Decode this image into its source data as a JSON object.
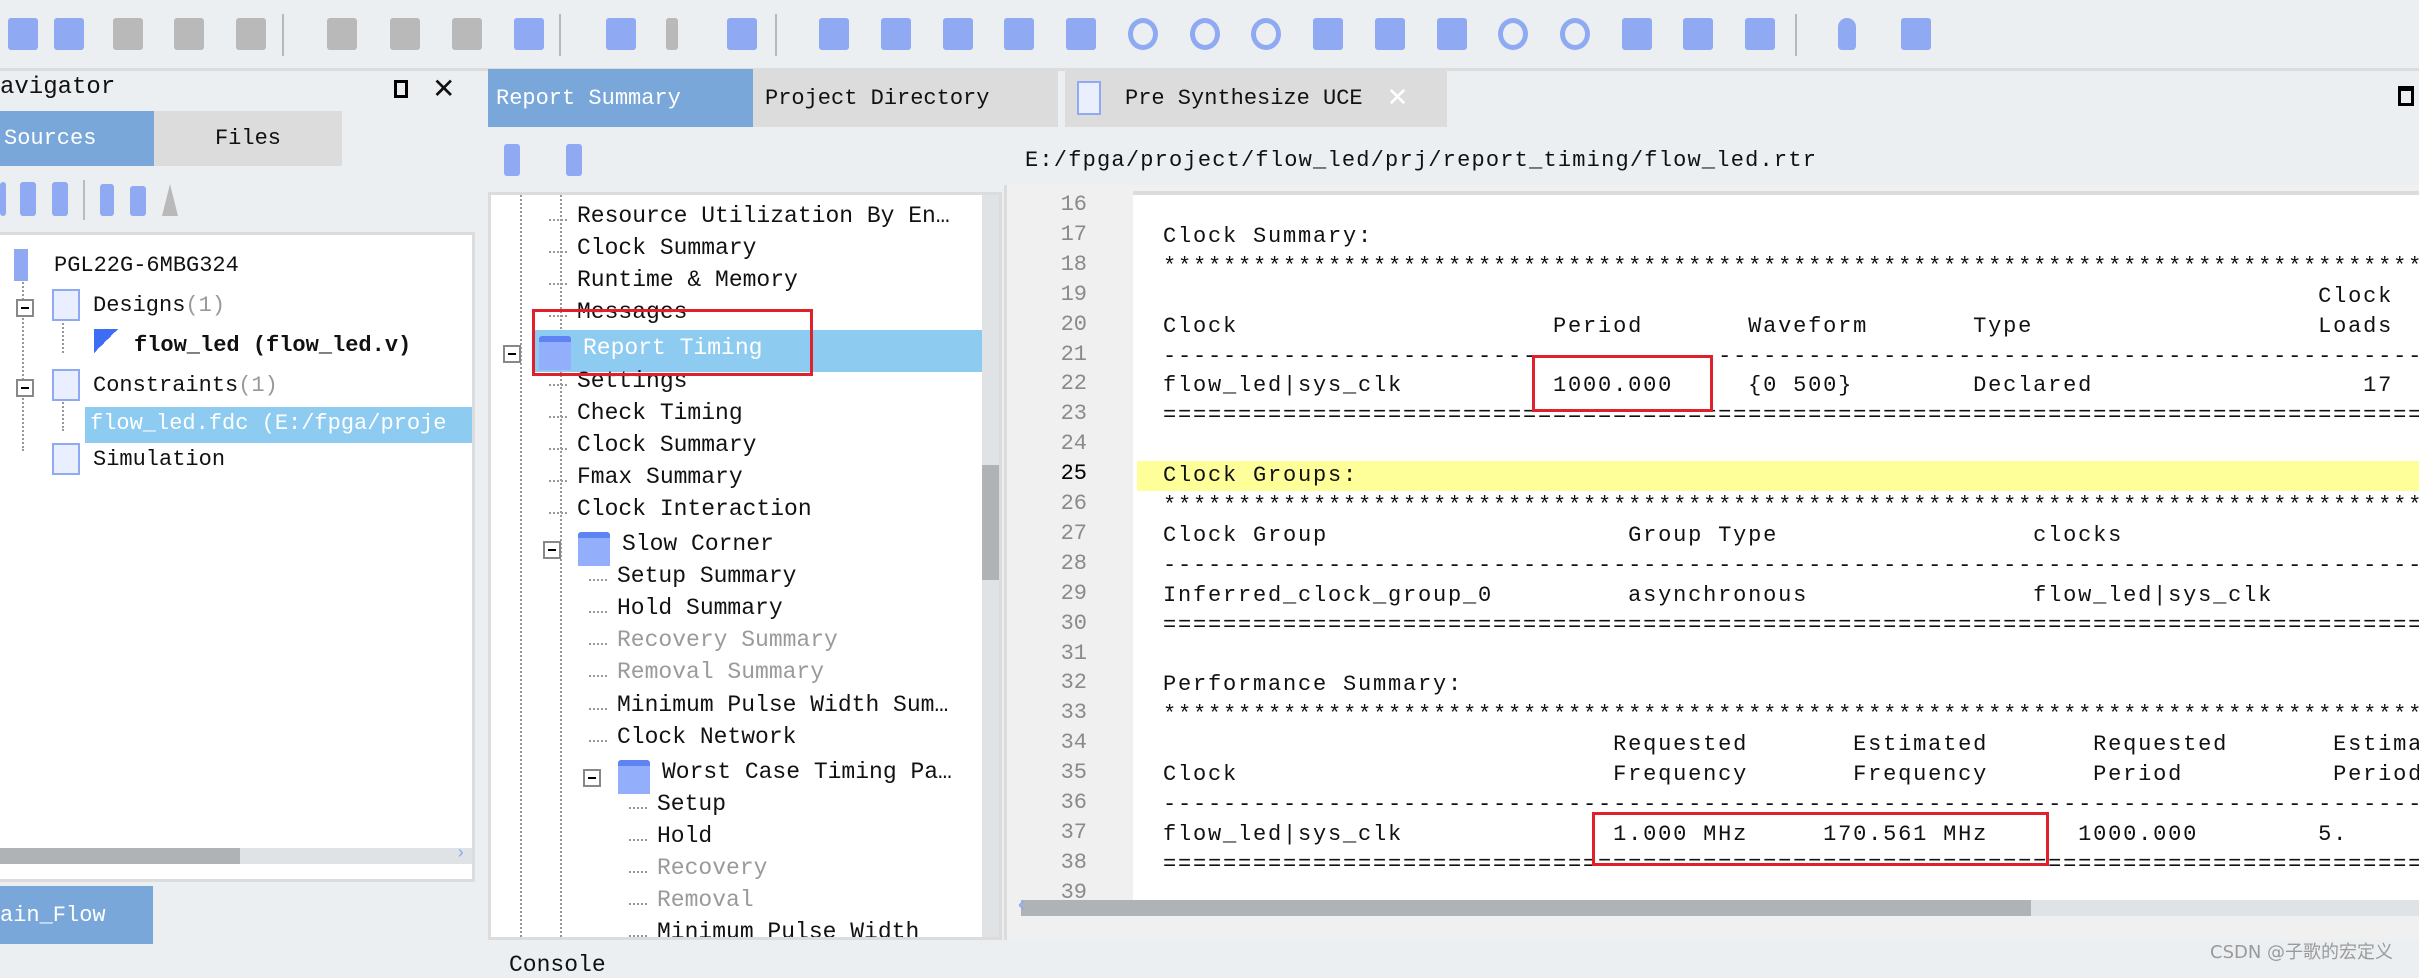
{
  "toolbar": {
    "icons": [
      "new-file-icon",
      "open-folder-icon",
      "save-icon",
      "save-as-icon",
      "save-all-icon",
      "cut-icon",
      "copy-icon",
      "paste-icon",
      "find-icon",
      "run-icon",
      "pause-icon",
      "settings-gear-icon",
      "edit-constraints-icon",
      "report-icon",
      "schematic-icon",
      "hierarchy-icon",
      "device-map-icon",
      "flash-refresh-icon",
      "timing-refresh-icon",
      "waveform-icon",
      "timing-analyzer-icon",
      "io-icon",
      "debug-bug-icon",
      "download-icon",
      "ip-icon",
      "chart-icon",
      "net-tree-icon",
      "org-tree-icon",
      "tip-bulb-icon",
      "exit-icon"
    ]
  },
  "navigator": {
    "title": "avigator",
    "tabs": [
      {
        "label": "Sources"
      },
      {
        "label": "Files"
      }
    ],
    "tree": [
      {
        "label": "PGL22G-6MBG324",
        "icon": "chip-icon"
      },
      {
        "label": "Designs",
        "count": "(1)",
        "icon": "document-icon"
      },
      {
        "label": "flow_led (flow_led.v)",
        "icon": "verilog-module-icon",
        "bold": true
      },
      {
        "label": "Constraints",
        "count": "(1)",
        "icon": "constraints-icon"
      },
      {
        "label": "flow_led.fdc (E:/fpga/proje",
        "selected": true
      },
      {
        "label": "Simulation",
        "icon": "document-icon"
      }
    ],
    "bottom_tab": "ain_Flow"
  },
  "report": {
    "tabs": [
      {
        "label": "Report Summary",
        "active": true
      },
      {
        "label": "Project Directory"
      },
      {
        "label": "Pre Synthesize UCE",
        "closable": true
      }
    ],
    "tree": [
      {
        "label": "Resource Utilization By En…",
        "level": 1
      },
      {
        "label": "Clock Summary",
        "level": 1
      },
      {
        "label": "Runtime & Memory",
        "level": 1
      },
      {
        "label": "Messages",
        "level": 1
      },
      {
        "label": "Report Timing",
        "level": 0,
        "folder": true,
        "selected": true
      },
      {
        "label": "Settings",
        "level": 1
      },
      {
        "label": "Check Timing",
        "level": 1
      },
      {
        "label": "Clock Summary",
        "level": 1
      },
      {
        "label": "Fmax Summary",
        "level": 1
      },
      {
        "label": "Clock Interaction",
        "level": 1
      },
      {
        "label": "Slow Corner",
        "level": 1,
        "folder": true
      },
      {
        "label": "Setup Summary",
        "level": 2
      },
      {
        "label": "Hold Summary",
        "level": 2
      },
      {
        "label": "Recovery Summary",
        "level": 2,
        "disabled": true
      },
      {
        "label": "Removal Summary",
        "level": 2,
        "disabled": true
      },
      {
        "label": "Minimum Pulse Width Sum…",
        "level": 2
      },
      {
        "label": "Clock Network",
        "level": 2
      },
      {
        "label": "Worst Case Timing Pa…",
        "level": 2,
        "folder": true
      },
      {
        "label": "Setup",
        "level": 3
      },
      {
        "label": "Hold",
        "level": 3
      },
      {
        "label": "Recovery",
        "level": 3,
        "disabled": true
      },
      {
        "label": "Removal",
        "level": 3,
        "disabled": true
      },
      {
        "label": "Minimum Pulse Width",
        "level": 3
      }
    ],
    "console_label": "Console"
  },
  "editor": {
    "path": "E:/fpga/project/flow_led/prj/report_timing/flow_led.rtr",
    "current_line": 25,
    "lines": [
      {
        "n": "16",
        "text": ""
      },
      {
        "n": "17",
        "text": "Clock Summary:"
      },
      {
        "n": "18",
        "text": "****************************************************************************************************"
      },
      {
        "n": "19",
        "text": "                                                                             Clock"
      },
      {
        "n": "20",
        "text": "Clock                     Period       Waveform       Type                   Loads"
      },
      {
        "n": "21",
        "text": "----------------------------------------------------------------------------------------------------"
      },
      {
        "n": "22",
        "text": "flow_led|sys_clk          1000.000     {0 500}        Declared                  17"
      },
      {
        "n": "23",
        "text": "===================================================================================================="
      },
      {
        "n": "24",
        "text": ""
      },
      {
        "n": "25",
        "text": "Clock Groups:"
      },
      {
        "n": "26",
        "text": "****************************************************************************************************"
      },
      {
        "n": "27",
        "text": "Clock Group                    Group Type                 clocks"
      },
      {
        "n": "28",
        "text": "----------------------------------------------------------------------------------------------------"
      },
      {
        "n": "29",
        "text": "Inferred_clock_group_0         asynchronous               flow_led|sys_clk"
      },
      {
        "n": "30",
        "text": "===================================================================================================="
      },
      {
        "n": "31",
        "text": ""
      },
      {
        "n": "32",
        "text": "Performance Summary:"
      },
      {
        "n": "33",
        "text": "****************************************************************************************************"
      },
      {
        "n": "34",
        "text": "                              Requested       Estimated       Requested       Estima"
      },
      {
        "n": "35",
        "text": "Clock                         Frequency       Frequency       Period          Period"
      },
      {
        "n": "36",
        "text": "----------------------------------------------------------------------------------------------------"
      },
      {
        "n": "37",
        "text": "flow_led|sys_clk              1.000 MHz     170.561 MHz      1000.000        5."
      },
      {
        "n": "38",
        "text": "===================================================================================================="
      },
      {
        "n": "39",
        "text": ""
      }
    ]
  },
  "watermark": "CSDN @子歌的宏定义",
  "colors": {
    "accent_tab": "#79a7da",
    "selection": "#8ecbf0",
    "current_line": "#ffff99",
    "annotation_red": "#e0202a",
    "icon_blue": "#8fa9f2"
  }
}
